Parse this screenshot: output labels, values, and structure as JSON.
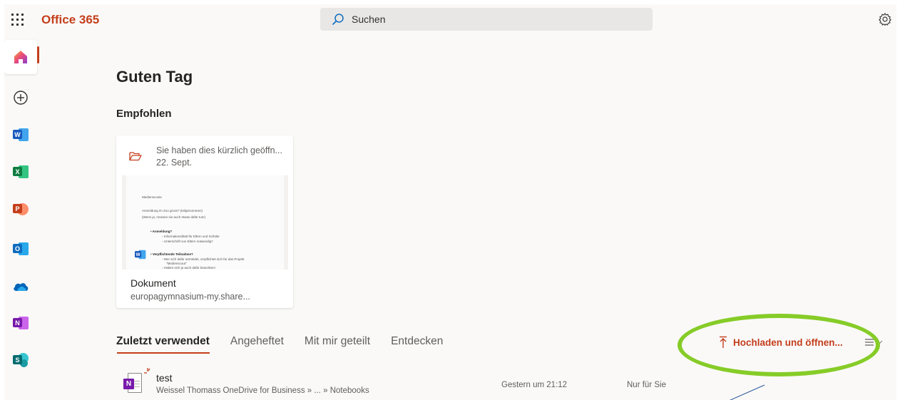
{
  "topbar": {
    "app_name": "Office 365",
    "search_placeholder": "Suchen"
  },
  "rail": {
    "items": [
      {
        "name": "Home",
        "icon": "home-icon"
      },
      {
        "name": "Create",
        "icon": "plus-circle-icon"
      },
      {
        "name": "Word",
        "icon": "word-icon",
        "letter": "W",
        "color": "#185abd"
      },
      {
        "name": "Excel",
        "icon": "excel-icon",
        "letter": "X",
        "color": "#107c41"
      },
      {
        "name": "PowerPoint",
        "icon": "powerpoint-icon",
        "letter": "P",
        "color": "#c43e1c"
      },
      {
        "name": "Outlook",
        "icon": "outlook-icon",
        "letter": "O",
        "color": "#0f6cbd"
      },
      {
        "name": "OneDrive",
        "icon": "onedrive-icon",
        "color": "#0364b8"
      },
      {
        "name": "OneNote",
        "icon": "onenote-icon",
        "letter": "N",
        "color": "#7719aa"
      },
      {
        "name": "SharePoint",
        "icon": "sharepoint-icon",
        "letter": "S",
        "color": "#036c70"
      }
    ]
  },
  "main": {
    "greeting": "Guten Tag",
    "recommended_heading": "Empfohlen",
    "card": {
      "activity": "Sie haben dies kürzlich geöffn...",
      "date": "22. Sept.",
      "title": "Dokument",
      "location": "europagymnasium-my.share...",
      "thumbnail_lines": [
        "Medienscouts",
        "Anmeldung im Zoo gross? (teilgenommen)",
        "(Wenn ja, müssen sie auch etwas dafür tun!)",
        "Anmeldung?",
        "Informationsblatt für Eltern und Schüler",
        "Unterschrift von Eltern notwendig?",
        "Verpflichtende Teilnahme?",
        "Wer sich dafür anmeldet, verpflichtet sich für das Projekt",
        "\"Medienscout\"",
        "Haben sich ja auch dafür beworben!"
      ]
    },
    "tabs": [
      {
        "label": "Zuletzt verwendet",
        "active": true
      },
      {
        "label": "Angeheftet",
        "active": false
      },
      {
        "label": "Mit mir geteilt",
        "active": false
      },
      {
        "label": "Entdecken",
        "active": false
      }
    ],
    "upload_label": "Hochladen und öffnen...",
    "files": [
      {
        "name": "test",
        "path": "Weissel Thomass OneDrive for Business » ... » Notebooks",
        "modified": "Gestern um 21:12",
        "sharing": "Nur für Sie",
        "icon": "onenote-file-icon"
      }
    ]
  },
  "colors": {
    "accent": "#c43e1c",
    "annotation_circle": "#86cc28",
    "background": "#faf9f8"
  }
}
